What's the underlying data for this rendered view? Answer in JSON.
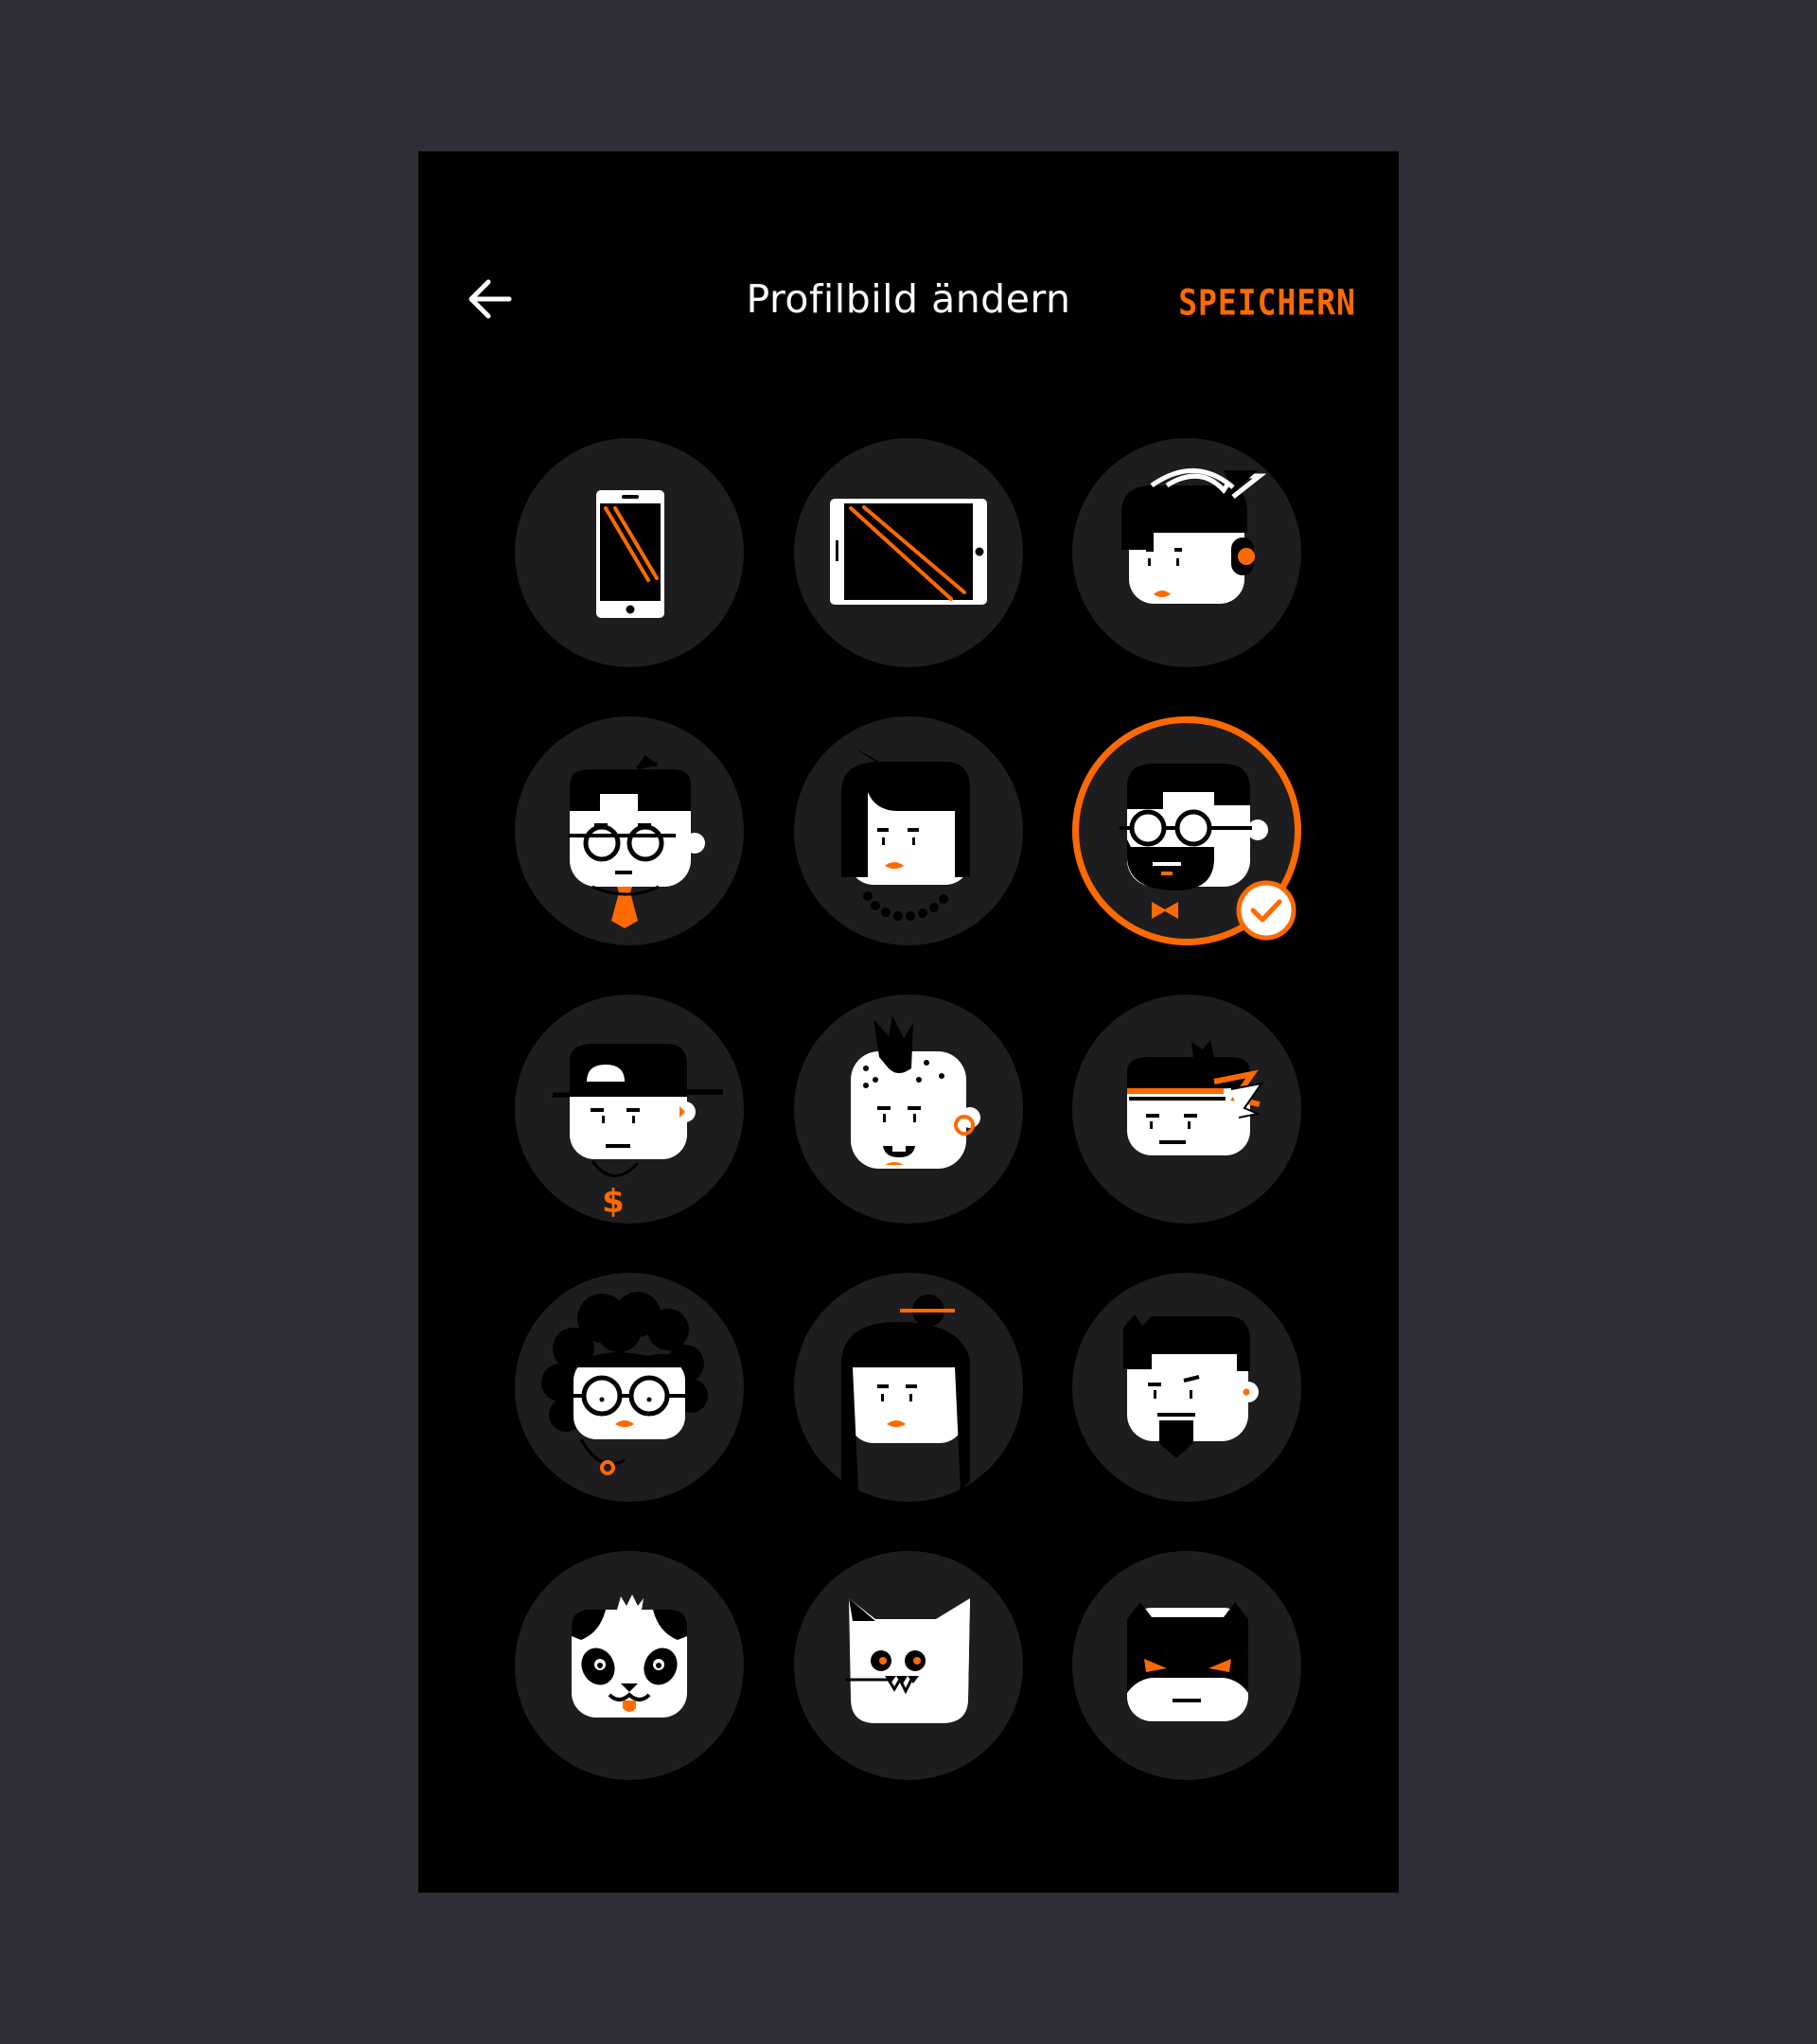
{
  "header": {
    "back_icon": "arrow-left-icon",
    "title": "Profilbild ändern",
    "save_label": "SPEICHERN"
  },
  "colors": {
    "background": "#2e2e36",
    "screen": "#000000",
    "avatar_circle": "#1d1d1f",
    "accent": "#ff6a00",
    "face": "#ffffff"
  },
  "avatars": [
    {
      "name": "phone-portrait-avatar",
      "selected": false
    },
    {
      "name": "tablet-landscape-avatar",
      "selected": false
    },
    {
      "name": "headphones-girl-avatar",
      "selected": false
    },
    {
      "name": "glasses-tie-guy-avatar",
      "selected": false
    },
    {
      "name": "pearl-necklace-woman-avatar",
      "selected": false
    },
    {
      "name": "bearded-hipster-bowtie-avatar",
      "selected": true
    },
    {
      "name": "cap-dollar-chain-avatar",
      "selected": false
    },
    {
      "name": "mohawk-punk-avatar",
      "selected": false
    },
    {
      "name": "headband-ninja-avatar",
      "selected": false
    },
    {
      "name": "curly-hair-glasses-woman-avatar",
      "selected": false
    },
    {
      "name": "hair-bun-woman-avatar",
      "selected": false
    },
    {
      "name": "goatee-guy-avatar",
      "selected": false
    },
    {
      "name": "panda-avatar",
      "selected": false
    },
    {
      "name": "ghost-cat-avatar",
      "selected": false
    },
    {
      "name": "bat-mask-avatar",
      "selected": false
    }
  ],
  "selected_icon": "checkmark-badge-icon"
}
